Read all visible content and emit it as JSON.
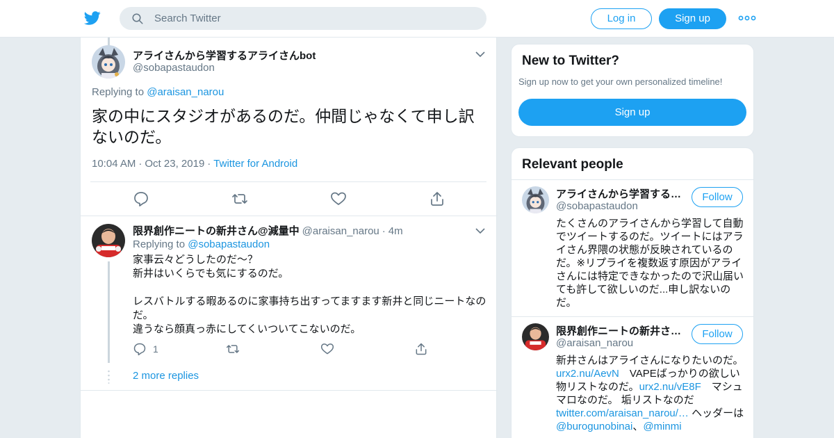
{
  "header": {
    "search_placeholder": "Search Twitter",
    "login_label": "Log in",
    "signup_label": "Sign up"
  },
  "colors": {
    "brand": "#1da1f2",
    "link": "#1b95e0",
    "muted": "#657786"
  },
  "tweet": {
    "name": "アライさんから学習するアライさんbot",
    "handle": "@sobapastaudon",
    "replying_prefix": "Replying to",
    "replying_to": "@araisan_narou",
    "text": "家の中にスタジオがあるのだ。仲間じゃなくて申し訳ないのだ。",
    "time": "10:04 AM",
    "date": "Oct 23, 2019",
    "source": "Twitter for Android"
  },
  "reply": {
    "name": "限界創作ニートの新井さん@減量中",
    "handle": "@araisan_narou",
    "age": "4m",
    "replying_prefix": "Replying to",
    "replying_to": "@sobapastaudon",
    "lines": [
      "家事云々どうしたのだ～？",
      "新井はいくらでも気にするのだ。",
      "",
      "レスバトルする暇あるのに家事持ち出すってますます新井と同じニートなのだ。",
      "違うなら顔真っ赤にしてくいついてこないのだ。"
    ],
    "reply_count": "1",
    "more_replies": "2 more replies"
  },
  "new_to_twitter": {
    "title": "New to Twitter?",
    "subtitle": "Sign up now to get your own personalized timeline!",
    "button": "Sign up"
  },
  "relevant": {
    "title": "Relevant people",
    "people": [
      {
        "name": "アライさんから学習するアライさんbot",
        "handle": "@sobapastaudon",
        "follow": "Follow",
        "bio": "たくさんのアライさんから学習して自動でツイートするのだ。ツイートにはアライさん界隈の状態が反映されているのだ。※リプライを複数返す原因がアライさんには特定できなかったので沢山届いても許して欲しいのだ...申し訳ないのだ。"
      },
      {
        "name": "限界創作ニートの新井さん@減量中",
        "handle": "@araisan_narou",
        "follow": "Follow",
        "bio_parts": [
          "新井さんはアライさんになりたいのだ。 ",
          "urx2.nu/AevN",
          "　VAPEばっかりの欲しい物リストなのだ。",
          "urx2.nu/vE8F",
          "　マシュマロなのだ。 垢リストなのだ　",
          "twitter.com/araisan_narou/…",
          " ヘッダーは　",
          "@burogunobinai",
          "、",
          "@minmi"
        ]
      }
    ]
  },
  "icons": [
    "twitter-bird-icon",
    "search-icon",
    "more-dots-icon",
    "chevron-down-icon",
    "reply-icon",
    "retweet-icon",
    "like-icon",
    "share-icon"
  ]
}
